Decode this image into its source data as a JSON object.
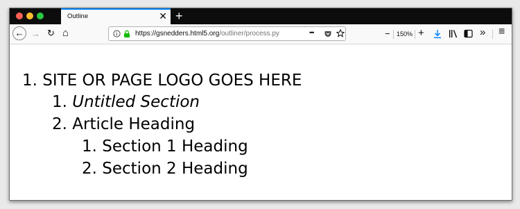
{
  "window": {
    "tab_title": "Outline",
    "tab_close": "✕",
    "new_tab": "+"
  },
  "toolbar": {
    "back_icon": "←",
    "forward_icon": "→",
    "reload_icon": "↻",
    "home_icon": "⌂",
    "url_domain": "https://gsnedders.html5.org",
    "url_path": "/outliner/process.py",
    "more_icon": "•••",
    "zoom_out": "−",
    "zoom_level": "150%",
    "zoom_in": "+",
    "overflow_icon": "»",
    "menu_icon": "≡"
  },
  "outline": [
    {
      "number": "1.",
      "text": "SITE OR PAGE LOGO GOES HERE",
      "italic": false
    },
    {
      "number": "1.",
      "text": "Untitled Section",
      "italic": true
    },
    {
      "number": "2.",
      "text": "Article Heading",
      "italic": false
    },
    {
      "number": "1.",
      "text": "Section 1 Heading",
      "italic": false
    },
    {
      "number": "2.",
      "text": "Section 2 Heading",
      "italic": false
    }
  ]
}
